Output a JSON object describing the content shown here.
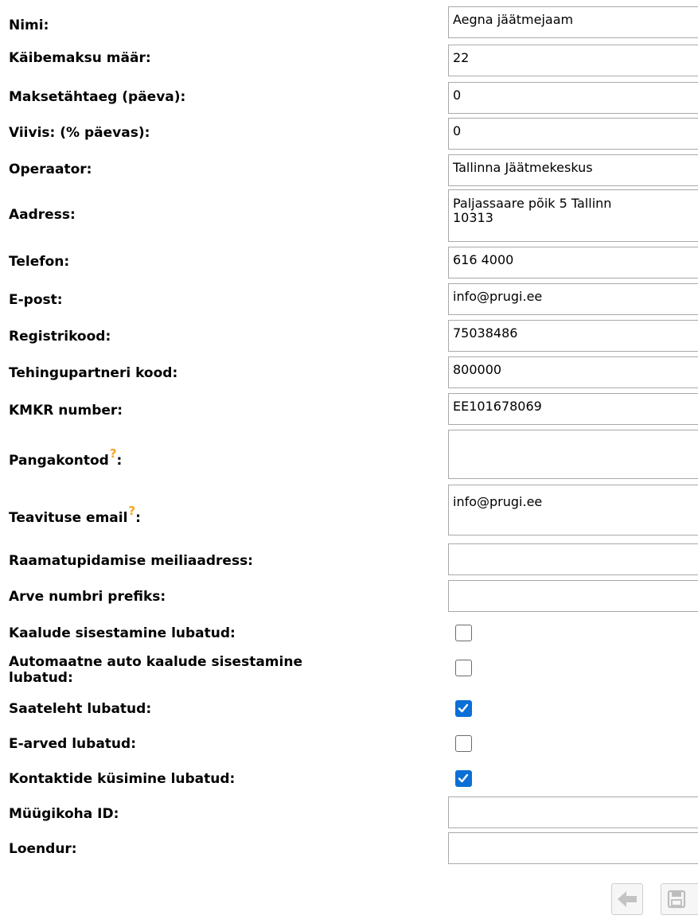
{
  "fields": [
    {
      "label": "Nimi:",
      "value": "Aegna jäätmejaam"
    },
    {
      "label": "Käibemaksu määr:",
      "value": "22"
    },
    {
      "label": "Maksetähtaeg (päeva):",
      "value": "0"
    },
    {
      "label": "Viivis: (% päevas):",
      "value": "0"
    },
    {
      "label": "Operaator:",
      "value": "Tallinna Jäätmekeskus"
    },
    {
      "label": "Aadress:",
      "value": "Paljassaare põik 5 Tallinn\n10313"
    },
    {
      "label": "Telefon:",
      "value": "616 4000"
    },
    {
      "label": "E-post:",
      "value": "info@prugi.ee"
    },
    {
      "label": "Registrikood:",
      "value": "75038486"
    },
    {
      "label": "Tehingupartneri kood:",
      "value": "800000"
    },
    {
      "label": "KMKR number:",
      "value": "EE101678069"
    },
    {
      "label": "Pangakontod",
      "help": "?",
      "suffix": ":",
      "value": ""
    },
    {
      "label": "Teavituse email",
      "help": "?",
      "suffix": ":",
      "value": "info@prugi.ee"
    },
    {
      "label": "Raamatupidamise meiliaadress:",
      "value": ""
    },
    {
      "label": "Arve numbri prefiks:",
      "value": ""
    }
  ],
  "checkboxes": [
    {
      "label": "Kaalude sisestamine lubatud:",
      "checked": false
    },
    {
      "label": "Automaatne auto kaalude sisestamine\nlubatud:",
      "checked": false
    },
    {
      "label": "Saateleht lubatud:",
      "checked": true
    },
    {
      "label": "E-arved lubatud:",
      "checked": false
    },
    {
      "label": "Kontaktide küsimine lubatud:",
      "checked": true
    }
  ],
  "extra_fields": [
    {
      "label": "Müügikoha ID:",
      "value": ""
    },
    {
      "label": "Loendur:",
      "value": ""
    }
  ],
  "toolbar": {
    "back_icon": "arrow-left-icon",
    "save_icon": "floppy-disk-icon"
  },
  "colors": {
    "checkbox_checked": "#0b6fd6",
    "help_mark": "#f5a623",
    "input_border": "#a9a9a9"
  }
}
